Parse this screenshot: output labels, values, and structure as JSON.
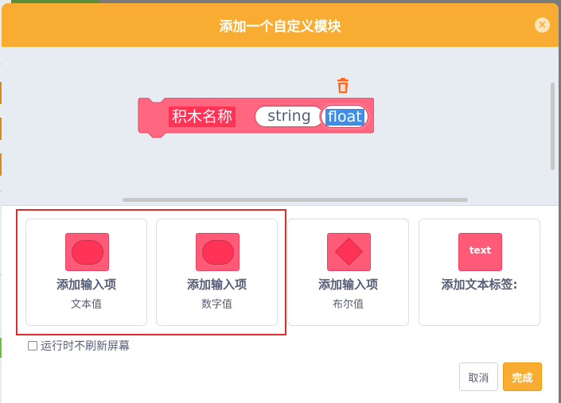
{
  "dialog": {
    "title": "添加一个自定义模块",
    "close_icon": "×"
  },
  "preview_block": {
    "name": "积木名称",
    "inputs": [
      "string",
      "float"
    ],
    "selected_input": "float",
    "delete_icon": "trash-icon"
  },
  "options": [
    {
      "title": "添加输入项",
      "subtitle": "文本值",
      "shape": "round"
    },
    {
      "title": "添加输入项",
      "subtitle": "数字值",
      "shape": "round"
    },
    {
      "title": "添加输入项",
      "subtitle": "布尔值",
      "shape": "diamond"
    },
    {
      "title": "添加文本标签:",
      "subtitle": "",
      "shape": "text",
      "thumb_text": "text"
    }
  ],
  "checkbox": {
    "label": "运行时不刷新屏幕",
    "checked": false
  },
  "buttons": {
    "cancel": "取消",
    "done": "完成"
  },
  "colors": {
    "header": "#f8ad32",
    "block": "#ff6680",
    "highlight": "#e02b2b",
    "selection": "#3f8de6"
  }
}
